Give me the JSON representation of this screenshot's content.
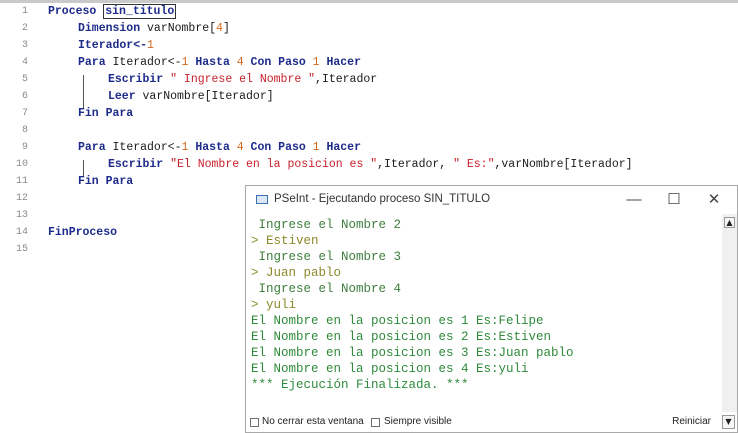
{
  "editor": {
    "line_numbers": [
      "1",
      "2",
      "3",
      "4",
      "5",
      "6",
      "7",
      "8",
      "9",
      "10",
      "11",
      "12",
      "13",
      "14",
      "15"
    ],
    "l1_kw": "Proceso",
    "l1_name": "sin_titulo",
    "l2_kw": "Dimension",
    "l2_rest": " varNombre[",
    "l2_num": "4",
    "l2_end": "]",
    "l3_a": "Iterador<-",
    "l3_num": "1",
    "l4_kw1": "Para",
    "l4_a": " Iterador<-",
    "l4_n1": "1",
    "l4_kw2": " Hasta ",
    "l4_n2": "4",
    "l4_kw3": " Con Paso ",
    "l4_n3": "1",
    "l4_kw4": " Hacer",
    "l5_kw": "Escribir",
    "l5_str": " \" Ingrese el Nombre \"",
    "l5_rest": ",Iterador",
    "l6_kw": "Leer",
    "l6_rest": " varNombre[Iterador]",
    "l7_kw": "Fin Para",
    "l9_kw1": "Para",
    "l9_a": " Iterador<-",
    "l9_n1": "1",
    "l9_kw2": " Hasta ",
    "l9_n2": "4",
    "l9_kw3": " Con Paso ",
    "l9_n3": "1",
    "l9_kw4": " Hacer",
    "l10_kw": "Escribir",
    "l10_str1": " \"El Nombre en la posicion es \"",
    "l10_mid": ",Iterador, ",
    "l10_str2": "\" Es:\"",
    "l10_end": ",varNombre[Iterador]",
    "l11_kw": "Fin Para",
    "l14_kw": "FinProceso"
  },
  "console": {
    "title": "PSeInt - Ejecutando proceso SIN_TITULO",
    "minimize": "—",
    "maximize": "☐",
    "close": "✕",
    "lines": [
      " Ingrese el Nombre 2",
      "> Estiven",
      " Ingrese el Nombre 3",
      "> Juan pablo",
      " Ingrese el Nombre 4",
      "> yuli",
      "El Nombre en la posicion es 1 Es:Felipe",
      "El Nombre en la posicion es 2 Es:Estiven",
      "El Nombre en la posicion es 3 Es:Juan pablo",
      "El Nombre en la posicion es 4 Es:yuli",
      "*** Ejecución Finalizada. ***"
    ],
    "no_close_label": "No cerrar esta ventana",
    "always_visible_label": "Siempre visible",
    "restart_label": "Reiniciar"
  }
}
